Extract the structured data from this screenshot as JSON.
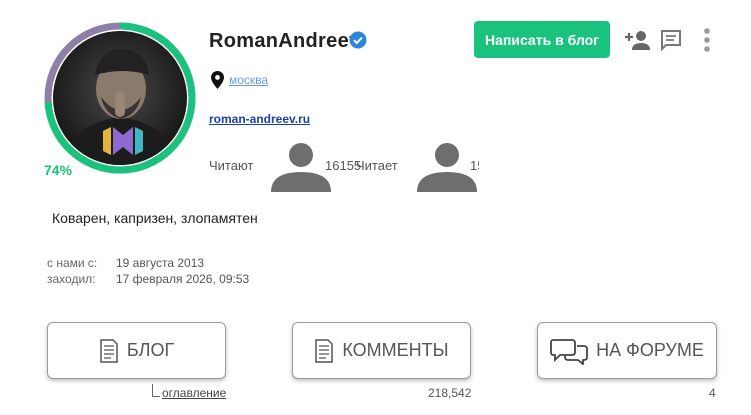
{
  "profile": {
    "username": "RomanAndreev",
    "verified": true,
    "progress_text": "74%",
    "progress_value": 0.74,
    "location": "москва",
    "website": "roman-andreev.ru",
    "bio": "Коварен, капризен, злопамятен"
  },
  "follow": {
    "followers_label": "Читают",
    "followers_count": "16155",
    "following_label": "Читает",
    "following_count": "15"
  },
  "actions": {
    "write_label": "Написать в блог"
  },
  "meta": {
    "joined_label": "с нами с:",
    "joined_value": "19 августа 2013",
    "visited_label": "заходил:",
    "visited_value": "17 февраля 2026, 09:53"
  },
  "tabs": [
    {
      "label": "БЛОГ",
      "icon": "document-icon"
    },
    {
      "label": "КОММЕНТЫ",
      "icon": "document-icon"
    },
    {
      "label": "НА ФОРУМЕ",
      "icon": "chat-bubbles-icon"
    }
  ],
  "tab_footer": {
    "toc_label": "оглавление",
    "comments_count": "218,542",
    "forum_count": "4"
  },
  "colors": {
    "accent": "#19c37d",
    "progress_track": "#8e7fa6",
    "link": "#1a3fb0"
  }
}
